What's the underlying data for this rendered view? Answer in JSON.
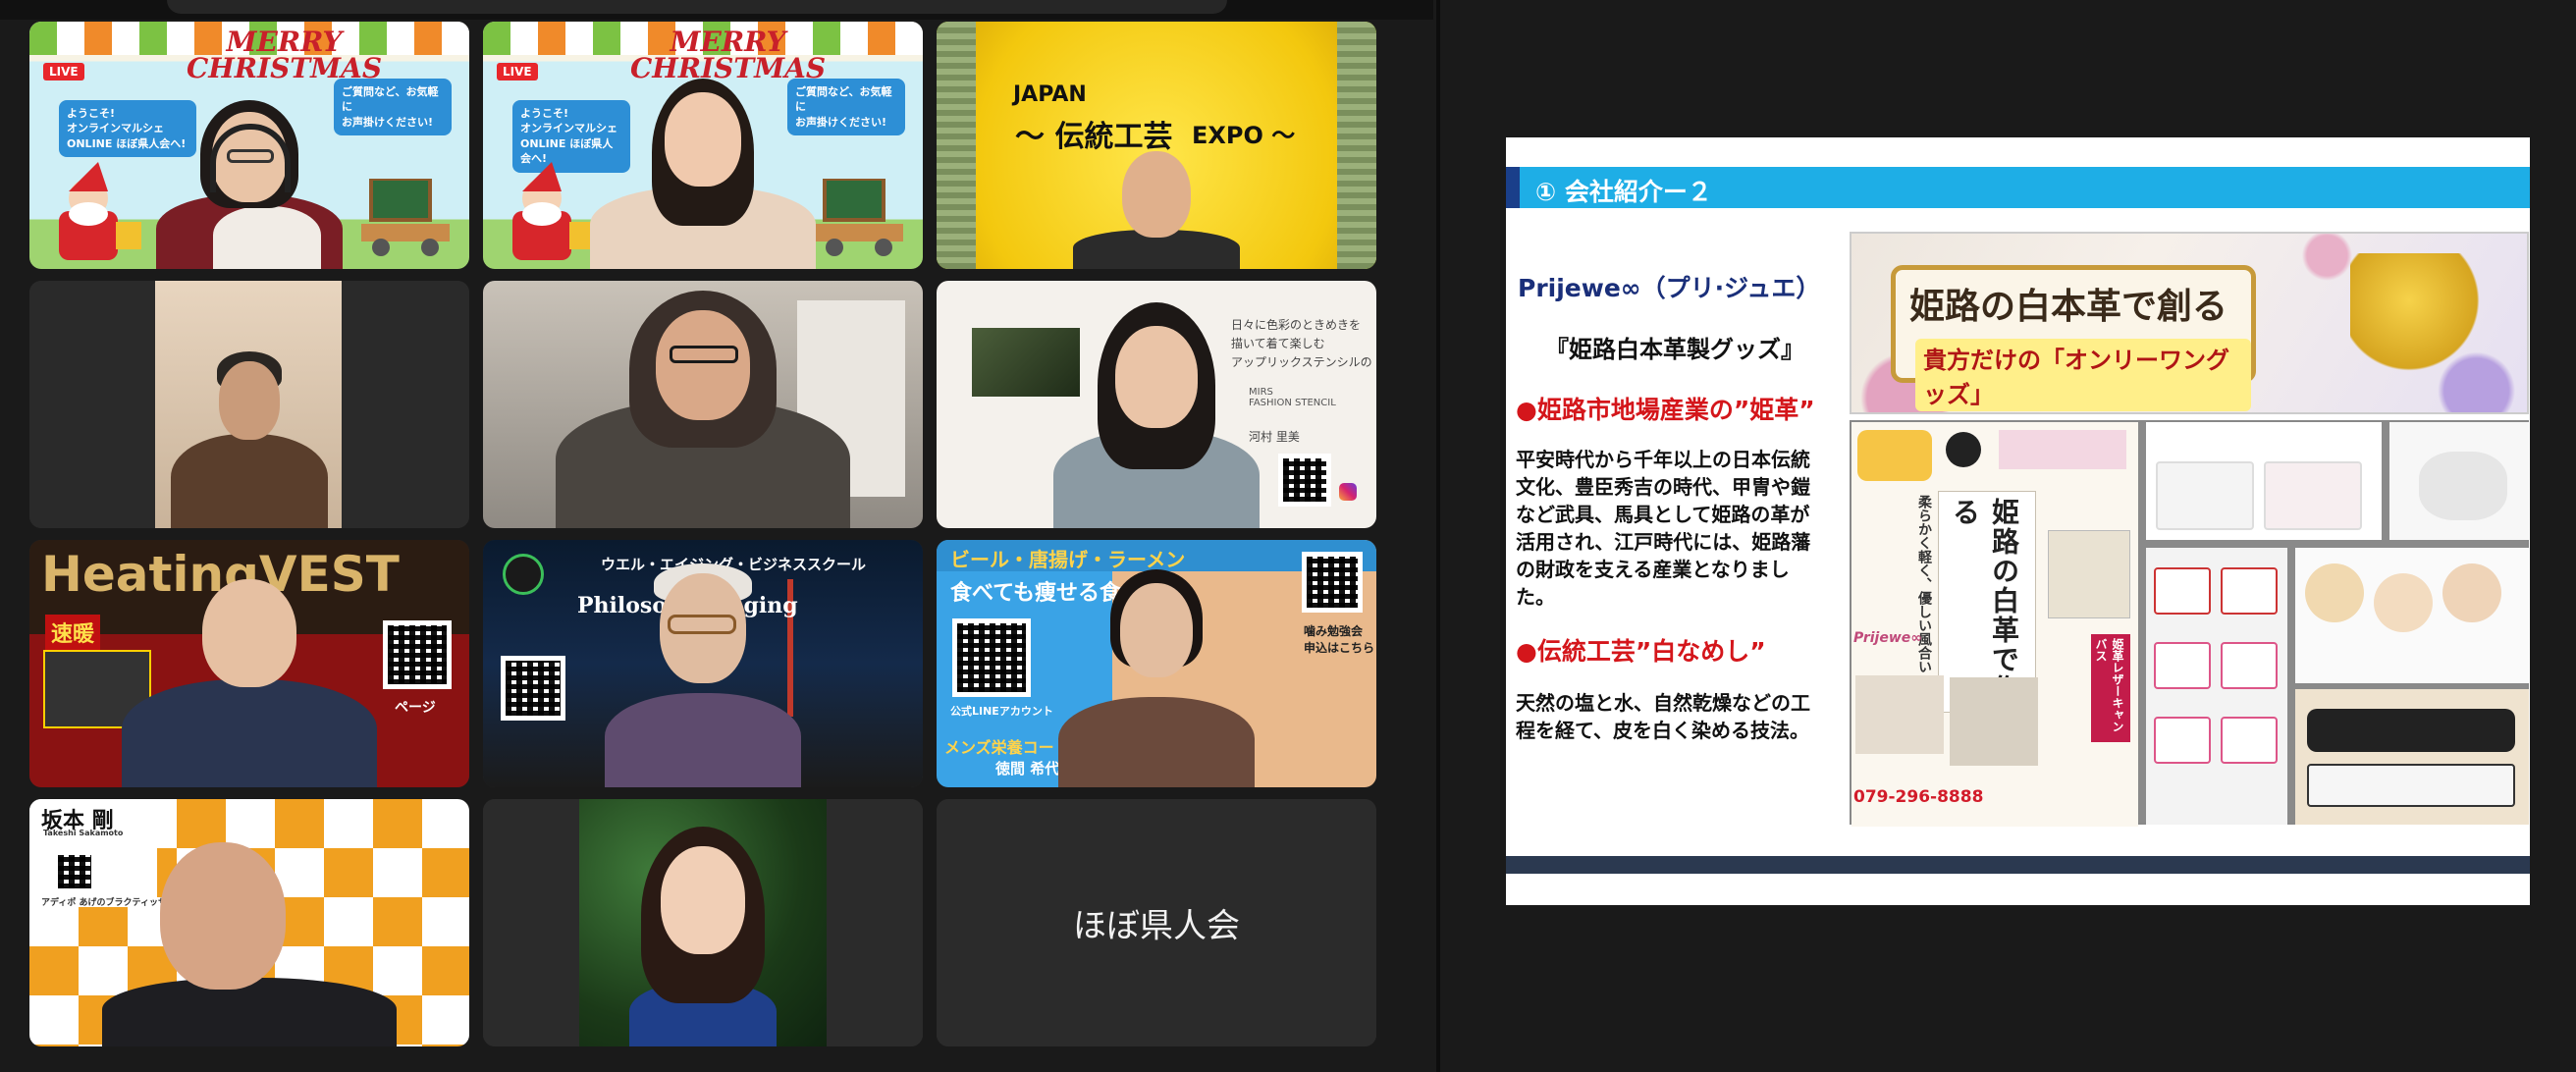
{
  "tiles": [
    {
      "key": "t1",
      "live": "LIVE",
      "xmas1": "MERRY",
      "xmas2": "CHRISTMAS",
      "bubble_left": "ようこそ!\nオンラインマルシェ\nONLINE ほぼ県人会へ!",
      "bubble_right": "ご質問など、お気軽に\nお声掛けください!"
    },
    {
      "key": "t2",
      "live": "LIVE",
      "xmas1": "MERRY",
      "xmas2": "CHRISTMAS",
      "bubble_left": "ようこそ!\nオンラインマルシェ\nONLINE ほぼ県人会へ!",
      "bubble_right": "ご質問など、お気軽に\nお声掛けください!"
    },
    {
      "key": "t3",
      "line1": "JAPAN",
      "line2": "〜 伝統工芸",
      "line3": "EXPO 〜"
    },
    {
      "key": "t4"
    },
    {
      "key": "t5"
    },
    {
      "key": "t6",
      "sign": "日々に色彩のときめきを\n描いて着て楽しむ\nアップリックステンシルの",
      "brand": "MIRS\nFASHION STENCIL",
      "name": "河村 里美"
    },
    {
      "key": "t7",
      "headline": "HeatingVEST",
      "badge": "速暖",
      "caption": "ページ"
    },
    {
      "key": "t8",
      "top": "ウエル・エイジング・ビジネススクール",
      "mid": "Philosop     ell Aging"
    },
    {
      "key": "t9",
      "top": "ビール・唐揚げ・ラーメン",
      "mid": "食べても痩せる食べ      す!",
      "side": "噛み勉強会\n申込はこちら",
      "line_label": "公式LINEアカウント",
      "bottom1": "メンズ栄養コー",
      "bottom2": "徳間 希代"
    },
    {
      "key": "t10",
      "name": "坂本 剛",
      "sub": "Takeshi Sakamoto",
      "desc": "アディポ あげのブラクティッサ"
    },
    {
      "key": "t11"
    },
    {
      "key": "t12",
      "display_name": "ほぼ県人会"
    }
  ],
  "slide": {
    "header_title": "① 会社紹介ー２",
    "brand": "Prijewe∞（プリ·ジュエ）",
    "product_line": "『姫路白本革製グッズ』",
    "section1": "●姫路市地場産業の”姫革”",
    "body1": [
      "平安時代から千年以上の日本伝統",
      "文化、豊臣秀吉の時代、甲冑や鎧",
      "など武具、馬具として姫路の革が",
      "活用され、江戸時代には、姫路藩",
      "の財政を支える産業となりまし",
      "た。"
    ],
    "section2": "●伝統工芸”白なめし”",
    "body2": [
      "天然の塩と水、自然乾燥などの工",
      "程を経て、皮を白く染める技法。"
    ],
    "banner_line1": "姫路の白本革で創る",
    "banner_line2": "貴方だけの「オンリーワングッズ」",
    "leaflet_title": "姫路の白革で作る",
    "leaflet_sub": "柔らかく軽く、優しい風合い",
    "leaflet_phone": "079-296-8888",
    "leaflet_brand": "Prijewe∞",
    "leaflet_tag": "姫革レザーキャンバス"
  }
}
